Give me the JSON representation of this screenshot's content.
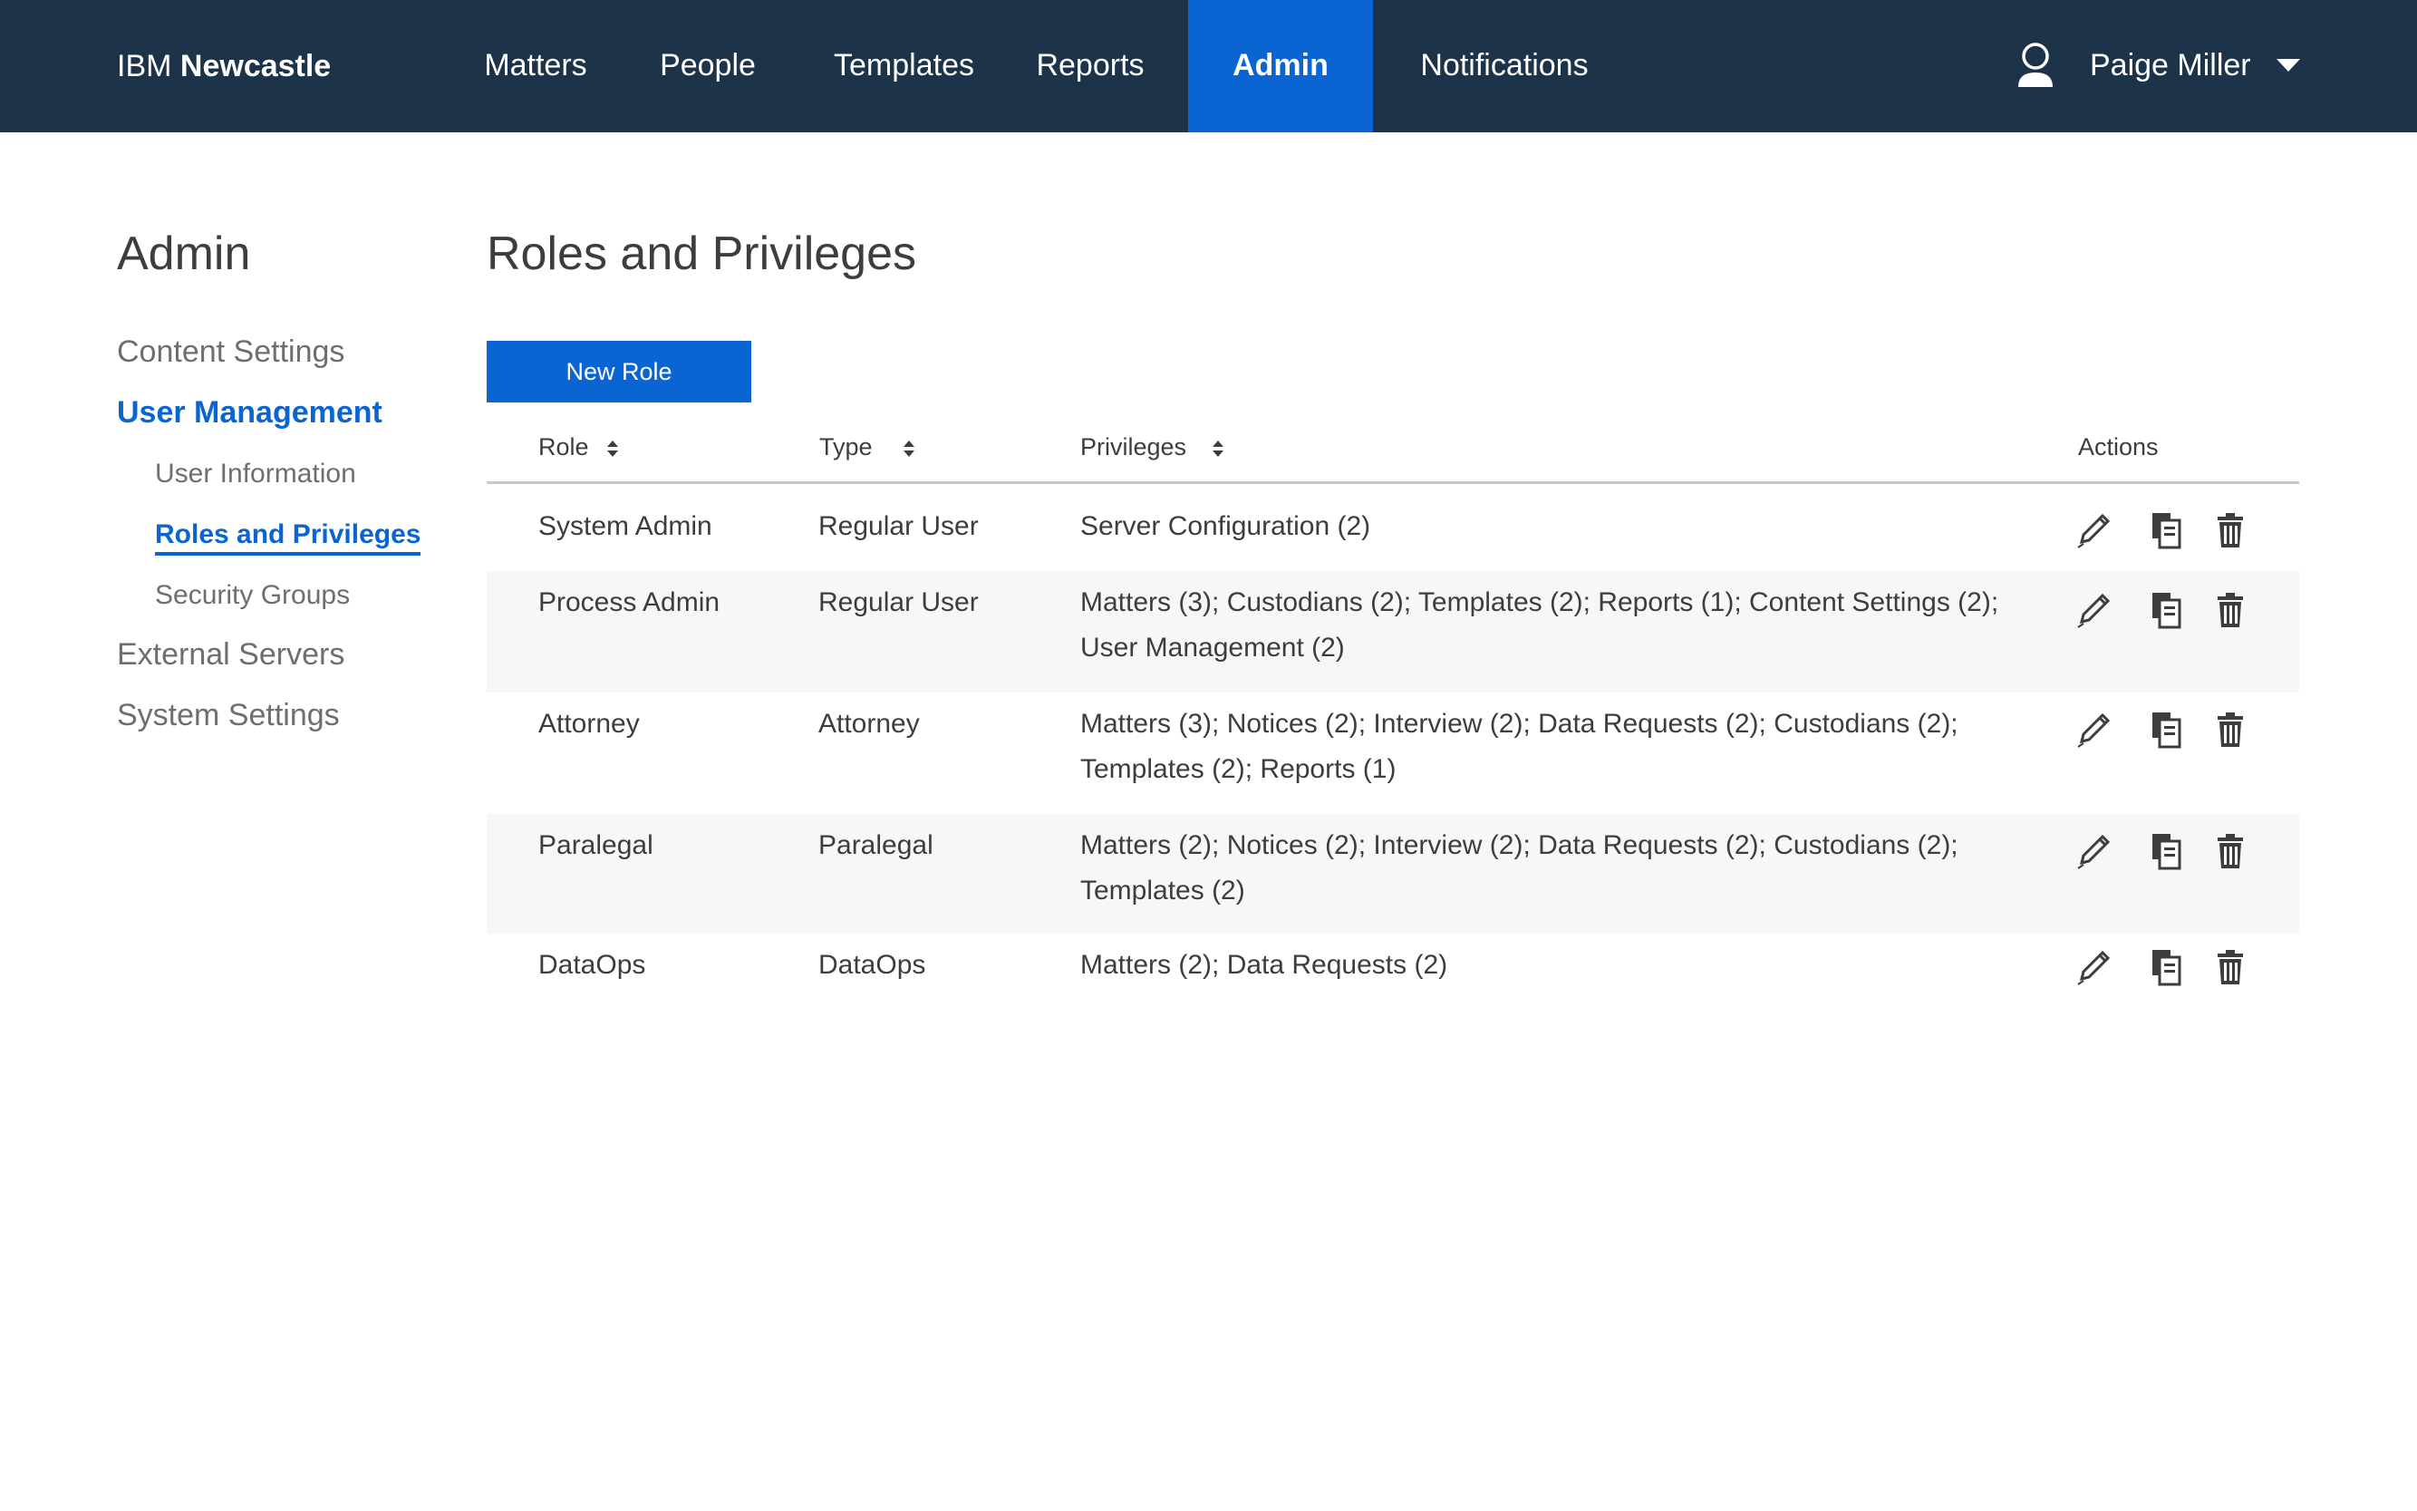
{
  "header": {
    "brand_prefix": "IBM",
    "brand_name": "Newcastle",
    "nav": [
      {
        "label": "Matters"
      },
      {
        "label": "People"
      },
      {
        "label": "Templates"
      },
      {
        "label": "Reports"
      },
      {
        "label": "Admin",
        "active": true
      },
      {
        "label": "Notifications"
      }
    ],
    "user_name": "Paige Miller",
    "active_color": "#0a64d2",
    "bar_color": "#1d3349"
  },
  "sidebar": {
    "title": "Admin",
    "items": [
      {
        "label": "Content Settings"
      },
      {
        "label": "User Management",
        "active": true
      },
      {
        "label": "User Information"
      },
      {
        "label": "Roles and Privileges",
        "active": true
      },
      {
        "label": "Security Groups"
      },
      {
        "label": "External Servers"
      },
      {
        "label": "System Settings"
      }
    ]
  },
  "main": {
    "title": "Roles and Privileges",
    "new_role_label": "New Role",
    "columns": {
      "role": "Role",
      "type": "Type",
      "privileges": "Privileges",
      "actions": "Actions"
    },
    "rows": [
      {
        "role": "System Admin",
        "type": "Regular User",
        "privileges": "Server Configuration (2)"
      },
      {
        "role": "Process Admin",
        "type": "Regular User",
        "privileges": "Matters (3); Custodians (2); Templates (2); Reports (1); Content Settings (2); User Management (2)"
      },
      {
        "role": "Attorney",
        "type": "Attorney",
        "privileges": "Matters (3); Notices (2); Interview (2); Data Requests (2); Custodians (2); Templates (2); Reports (1)"
      },
      {
        "role": "Paralegal",
        "type": "Paralegal",
        "privileges": "Matters (2); Notices (2); Interview (2); Data Requests (2); Custodians (2); Templates (2)"
      },
      {
        "role": "DataOps",
        "type": "DataOps",
        "privileges": "Matters (2); Data Requests (2)"
      }
    ],
    "action_icons": [
      "edit-icon",
      "copy-icon",
      "delete-icon"
    ]
  }
}
